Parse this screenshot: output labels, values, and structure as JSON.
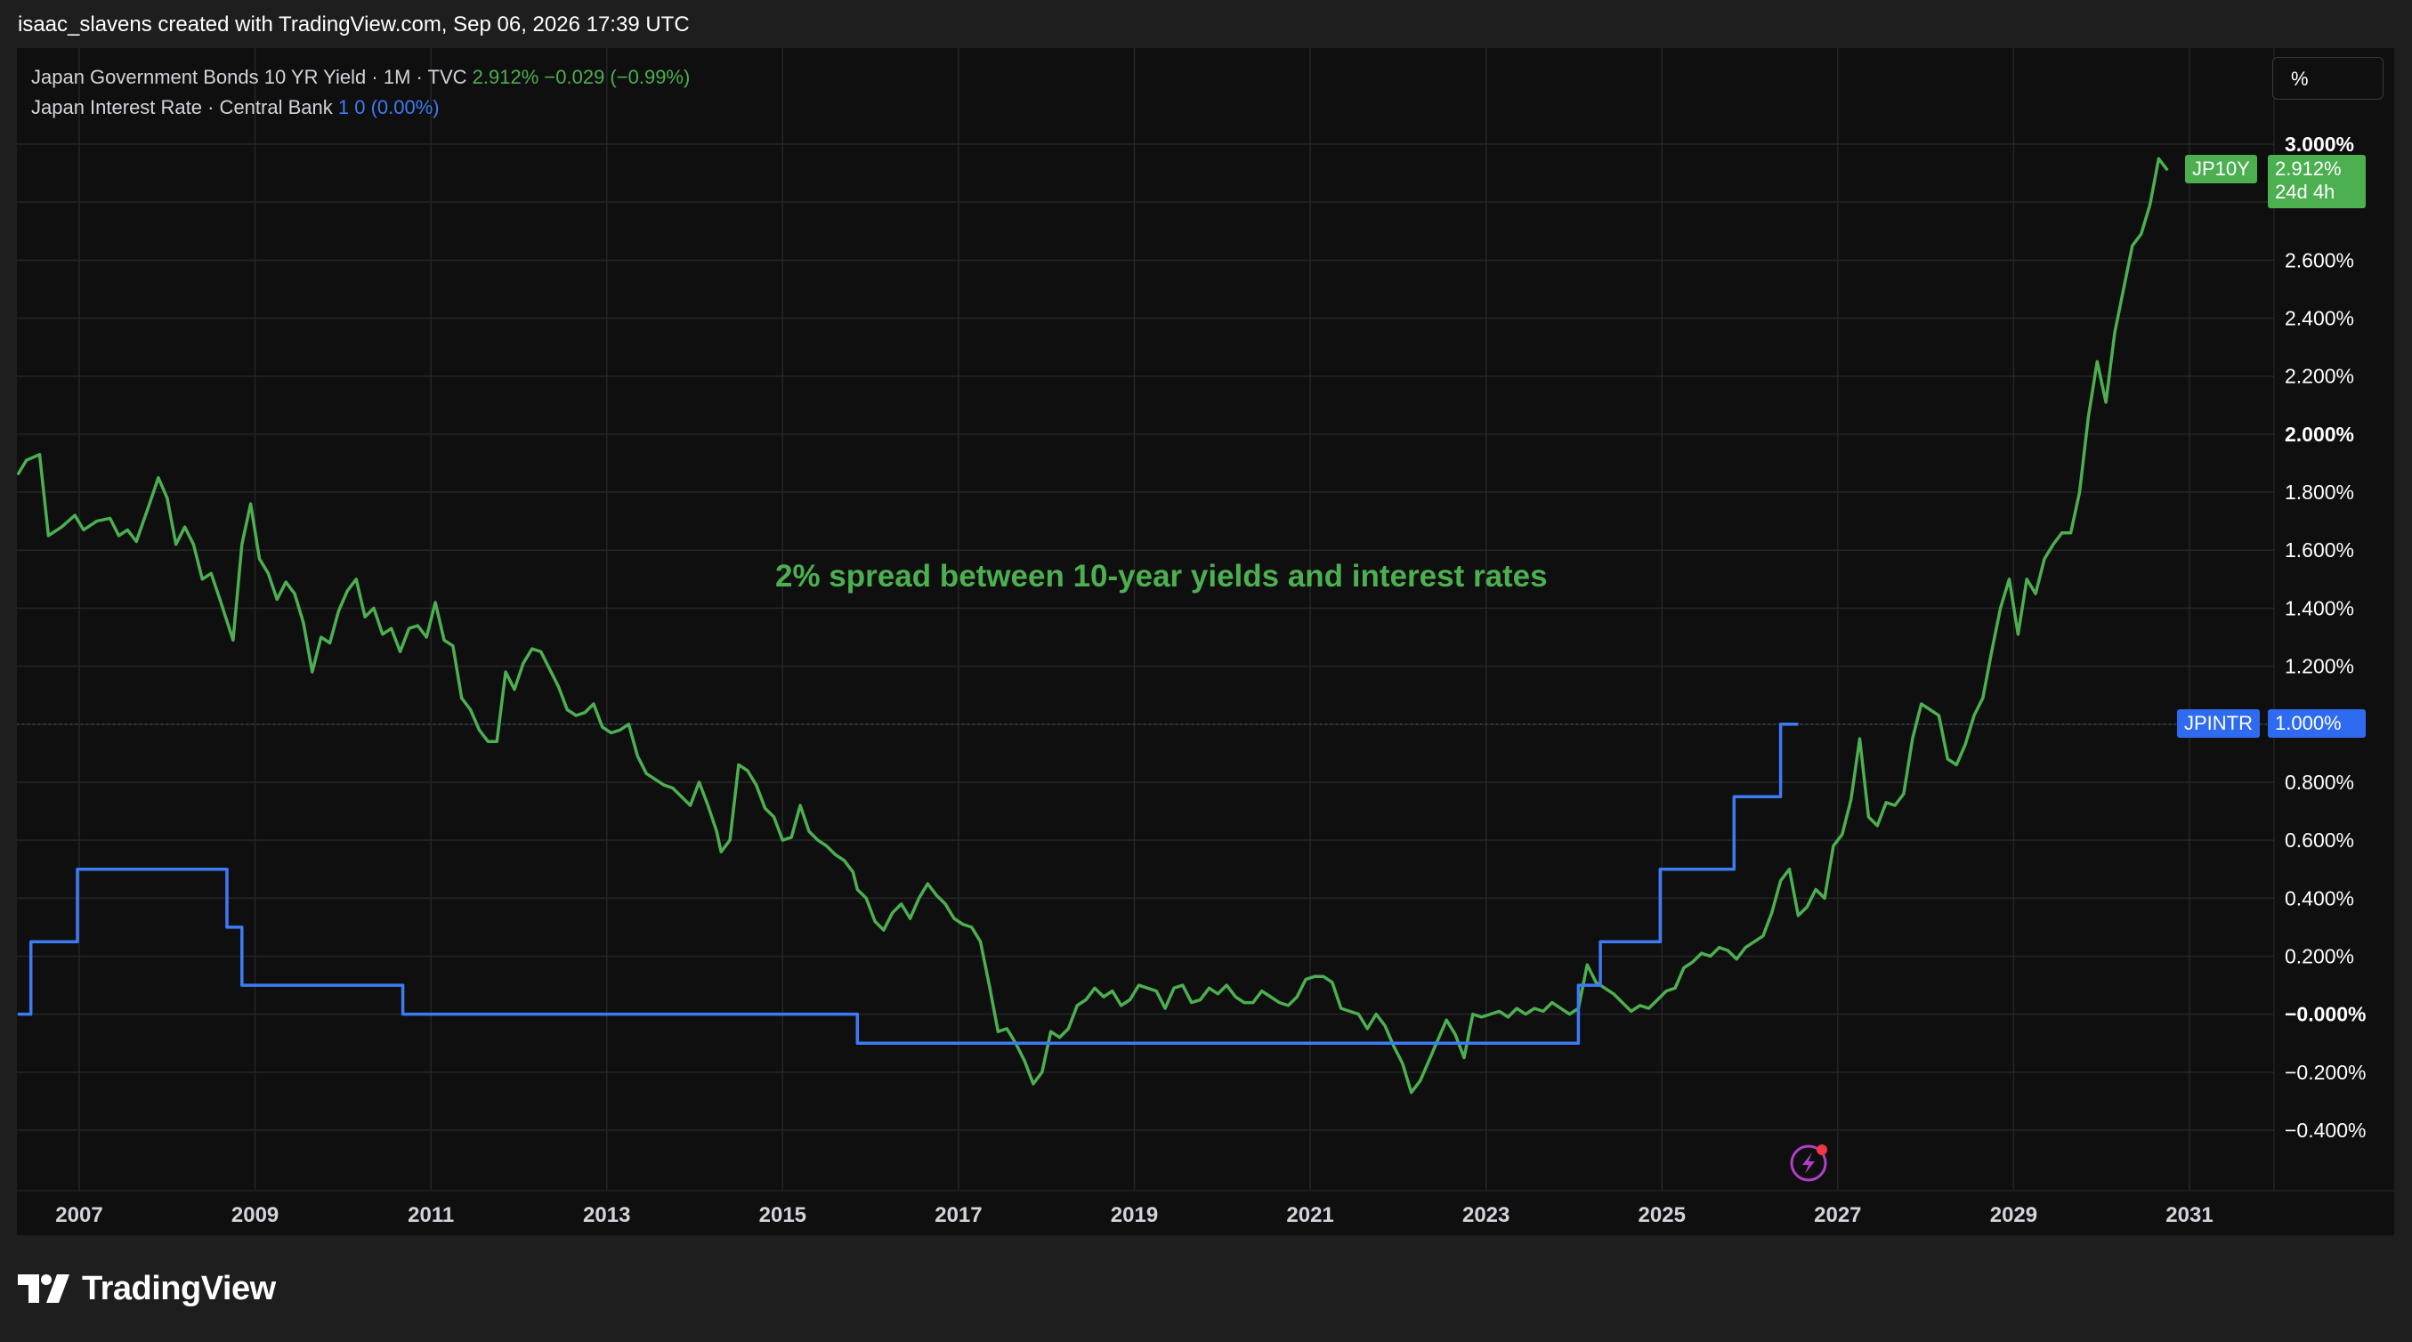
{
  "header": {
    "text": "isaac_slavens created with TradingView.com, Sep 06, 2026 17:39 UTC"
  },
  "legend": {
    "jp10y": {
      "label": "Japan Government Bonds 10 YR Yield · 1M · TVC",
      "value": "2.912%",
      "change": "−0.029 (−0.99%)"
    },
    "jpintr": {
      "label": "Japan Interest Rate · Central Bank",
      "value": "1",
      "change": "0 (0.00%)"
    }
  },
  "toolbar": {
    "percent_label": "%"
  },
  "annotation": {
    "text": "2% spread between 10-year yields and interest rates"
  },
  "price_tags": {
    "jp10y": {
      "symbol": "JP10Y",
      "value": "2.912%",
      "countdown": "24d 4h"
    },
    "jpintr": {
      "symbol": "JPINTR",
      "value": "1.000%"
    }
  },
  "footer": {
    "brand": "TradingView"
  },
  "colors": {
    "jp10y": "#4caf50",
    "jpintr": "#3d7bf5",
    "background": "#0f0f0f",
    "grid": "#2a2a2a"
  },
  "chart_data": {
    "type": "line",
    "x_range": [
      2006.3,
      2031.9
    ],
    "y_range": [
      -0.5,
      3.05
    ],
    "x_ticks": [
      "2007",
      "2009",
      "2011",
      "2013",
      "2015",
      "2017",
      "2019",
      "2021",
      "2023",
      "2025",
      "2027",
      "2029",
      "2031"
    ],
    "y_ticks": [
      "3.000%",
      "2.600%",
      "2.400%",
      "2.200%",
      "2.000%",
      "1.800%",
      "1.600%",
      "1.400%",
      "1.200%",
      "0.800%",
      "0.600%",
      "0.400%",
      "0.200%",
      "−0.000%",
      "−0.200%",
      "−0.400%"
    ],
    "series": [
      {
        "name": "Japan Government Bonds 10 YR Yield",
        "points": [
          [
            2006.3,
            1.86
          ],
          [
            2006.4,
            1.91
          ],
          [
            2006.55,
            1.93
          ],
          [
            2006.65,
            1.65
          ],
          [
            2006.8,
            1.68
          ],
          [
            2006.95,
            1.72
          ],
          [
            2007.05,
            1.67
          ],
          [
            2007.2,
            1.7
          ],
          [
            2007.35,
            1.71
          ],
          [
            2007.45,
            1.65
          ],
          [
            2007.55,
            1.67
          ],
          [
            2007.65,
            1.63
          ],
          [
            2007.8,
            1.76
          ],
          [
            2007.9,
            1.85
          ],
          [
            2008.0,
            1.78
          ],
          [
            2008.1,
            1.62
          ],
          [
            2008.2,
            1.68
          ],
          [
            2008.3,
            1.62
          ],
          [
            2008.4,
            1.5
          ],
          [
            2008.5,
            1.52
          ],
          [
            2008.6,
            1.43
          ],
          [
            2008.75,
            1.29
          ],
          [
            2008.85,
            1.62
          ],
          [
            2008.95,
            1.76
          ],
          [
            2009.05,
            1.57
          ],
          [
            2009.15,
            1.52
          ],
          [
            2009.25,
            1.43
          ],
          [
            2009.35,
            1.49
          ],
          [
            2009.45,
            1.45
          ],
          [
            2009.55,
            1.35
          ],
          [
            2009.65,
            1.18
          ],
          [
            2009.75,
            1.3
          ],
          [
            2009.85,
            1.28
          ],
          [
            2009.95,
            1.39
          ],
          [
            2010.05,
            1.46
          ],
          [
            2010.15,
            1.5
          ],
          [
            2010.25,
            1.37
          ],
          [
            2010.35,
            1.4
          ],
          [
            2010.45,
            1.31
          ],
          [
            2010.55,
            1.33
          ],
          [
            2010.65,
            1.25
          ],
          [
            2010.75,
            1.33
          ],
          [
            2010.85,
            1.34
          ],
          [
            2010.95,
            1.3
          ],
          [
            2011.05,
            1.42
          ],
          [
            2011.15,
            1.29
          ],
          [
            2011.25,
            1.27
          ],
          [
            2011.35,
            1.09
          ],
          [
            2011.45,
            1.05
          ],
          [
            2011.55,
            0.98
          ],
          [
            2011.65,
            0.94
          ],
          [
            2011.75,
            0.94
          ],
          [
            2011.85,
            1.18
          ],
          [
            2011.95,
            1.12
          ],
          [
            2012.05,
            1.21
          ],
          [
            2012.15,
            1.26
          ],
          [
            2012.25,
            1.25
          ],
          [
            2012.35,
            1.19
          ],
          [
            2012.45,
            1.13
          ],
          [
            2012.55,
            1.05
          ],
          [
            2012.65,
            1.03
          ],
          [
            2012.75,
            1.04
          ],
          [
            2012.85,
            1.07
          ],
          [
            2012.95,
            0.99
          ],
          [
            2013.05,
            0.97
          ],
          [
            2013.15,
            0.98
          ],
          [
            2013.25,
            1.0
          ],
          [
            2013.35,
            0.89
          ],
          [
            2013.45,
            0.83
          ],
          [
            2013.55,
            0.81
          ],
          [
            2013.65,
            0.79
          ],
          [
            2013.75,
            0.78
          ],
          [
            2013.85,
            0.75
          ],
          [
            2013.95,
            0.72
          ],
          [
            2014.05,
            0.8
          ],
          [
            2014.15,
            0.72
          ],
          [
            2014.25,
            0.63
          ],
          [
            2014.3,
            0.56
          ],
          [
            2014.4,
            0.6
          ],
          [
            2014.5,
            0.86
          ],
          [
            2014.6,
            0.84
          ],
          [
            2014.7,
            0.79
          ],
          [
            2014.8,
            0.71
          ],
          [
            2014.9,
            0.68
          ],
          [
            2015.0,
            0.6
          ],
          [
            2015.1,
            0.61
          ],
          [
            2015.2,
            0.72
          ],
          [
            2015.3,
            0.63
          ],
          [
            2015.4,
            0.6
          ],
          [
            2015.5,
            0.58
          ],
          [
            2015.6,
            0.55
          ],
          [
            2015.7,
            0.53
          ],
          [
            2015.8,
            0.49
          ],
          [
            2015.85,
            0.43
          ],
          [
            2015.95,
            0.4
          ],
          [
            2016.05,
            0.32
          ],
          [
            2016.15,
            0.29
          ],
          [
            2016.25,
            0.35
          ],
          [
            2016.35,
            0.38
          ],
          [
            2016.45,
            0.33
          ],
          [
            2016.55,
            0.4
          ],
          [
            2016.65,
            0.45
          ],
          [
            2016.75,
            0.41
          ],
          [
            2016.85,
            0.38
          ],
          [
            2016.95,
            0.33
          ],
          [
            2017.05,
            0.31
          ],
          [
            2017.15,
            0.3
          ],
          [
            2017.25,
            0.25
          ],
          [
            2017.35,
            0.1
          ],
          [
            2017.45,
            -0.06
          ],
          [
            2017.55,
            -0.05
          ],
          [
            2017.65,
            -0.1
          ],
          [
            2017.75,
            -0.16
          ],
          [
            2017.85,
            -0.24
          ],
          [
            2017.95,
            -0.2
          ],
          [
            2018.05,
            -0.06
          ],
          [
            2018.15,
            -0.08
          ],
          [
            2018.25,
            -0.05
          ],
          [
            2018.35,
            0.03
          ],
          [
            2018.45,
            0.05
          ],
          [
            2018.55,
            0.09
          ],
          [
            2018.65,
            0.06
          ],
          [
            2018.75,
            0.08
          ],
          [
            2018.85,
            0.03
          ],
          [
            2018.95,
            0.05
          ],
          [
            2019.05,
            0.1
          ],
          [
            2019.15,
            0.09
          ],
          [
            2019.25,
            0.08
          ],
          [
            2019.35,
            0.02
          ],
          [
            2019.45,
            0.09
          ],
          [
            2019.55,
            0.1
          ],
          [
            2019.65,
            0.04
          ],
          [
            2019.75,
            0.05
          ],
          [
            2019.85,
            0.09
          ],
          [
            2019.95,
            0.07
          ],
          [
            2020.05,
            0.1
          ],
          [
            2020.15,
            0.06
          ],
          [
            2020.25,
            0.04
          ],
          [
            2020.35,
            0.04
          ],
          [
            2020.45,
            0.08
          ],
          [
            2020.55,
            0.06
          ],
          [
            2020.65,
            0.04
          ],
          [
            2020.75,
            0.03
          ],
          [
            2020.85,
            0.06
          ],
          [
            2020.95,
            0.12
          ],
          [
            2021.05,
            0.13
          ],
          [
            2021.15,
            0.13
          ],
          [
            2021.25,
            0.11
          ],
          [
            2021.35,
            0.02
          ],
          [
            2021.45,
            0.01
          ],
          [
            2021.55,
            0.0
          ],
          [
            2021.65,
            -0.05
          ],
          [
            2021.75,
            0.0
          ],
          [
            2021.85,
            -0.04
          ],
          [
            2021.95,
            -0.11
          ],
          [
            2022.05,
            -0.17
          ],
          [
            2022.15,
            -0.27
          ],
          [
            2022.25,
            -0.23
          ],
          [
            2022.35,
            -0.16
          ],
          [
            2022.45,
            -0.09
          ],
          [
            2022.55,
            -0.02
          ],
          [
            2022.65,
            -0.07
          ],
          [
            2022.75,
            -0.15
          ],
          [
            2022.85,
            0.0
          ],
          [
            2022.95,
            -0.01
          ],
          [
            2023.05,
            0.0
          ],
          [
            2023.15,
            0.01
          ],
          [
            2023.25,
            -0.01
          ],
          [
            2023.35,
            0.02
          ],
          [
            2023.45,
            0.0
          ],
          [
            2023.55,
            0.02
          ],
          [
            2023.65,
            0.01
          ],
          [
            2023.75,
            0.04
          ],
          [
            2023.85,
            0.02
          ],
          [
            2023.95,
            0.0
          ],
          [
            2024.05,
            0.02
          ],
          [
            2024.15,
            0.17
          ],
          [
            2024.25,
            0.11
          ],
          [
            2024.35,
            0.09
          ],
          [
            2024.45,
            0.07
          ],
          [
            2024.55,
            0.04
          ],
          [
            2024.65,
            0.01
          ],
          [
            2024.75,
            0.03
          ],
          [
            2024.85,
            0.02
          ],
          [
            2024.95,
            0.05
          ],
          [
            2025.05,
            0.08
          ],
          [
            2025.15,
            0.09
          ],
          [
            2025.25,
            0.16
          ],
          [
            2025.35,
            0.18
          ],
          [
            2025.45,
            0.21
          ],
          [
            2025.55,
            0.2
          ],
          [
            2025.65,
            0.23
          ],
          [
            2025.75,
            0.22
          ],
          [
            2025.85,
            0.19
          ],
          [
            2025.95,
            0.23
          ],
          [
            2026.05,
            0.25
          ],
          [
            2026.15,
            0.27
          ],
          [
            2026.25,
            0.35
          ],
          [
            2026.35,
            0.46
          ],
          [
            2026.45,
            0.5
          ],
          [
            2026.55,
            0.34
          ],
          [
            2026.65,
            0.37
          ],
          [
            2026.75,
            0.43
          ],
          [
            2026.85,
            0.4
          ],
          [
            2026.95,
            0.58
          ],
          [
            2027.05,
            0.62
          ],
          [
            2027.15,
            0.74
          ],
          [
            2027.25,
            0.95
          ],
          [
            2027.35,
            0.68
          ],
          [
            2027.45,
            0.65
          ],
          [
            2027.55,
            0.73
          ],
          [
            2027.65,
            0.72
          ],
          [
            2027.75,
            0.76
          ],
          [
            2027.85,
            0.95
          ],
          [
            2027.95,
            1.07
          ],
          [
            2028.05,
            1.05
          ],
          [
            2028.15,
            1.03
          ],
          [
            2028.25,
            0.88
          ],
          [
            2028.35,
            0.86
          ],
          [
            2028.45,
            0.93
          ],
          [
            2028.55,
            1.03
          ],
          [
            2028.65,
            1.09
          ],
          [
            2028.75,
            1.25
          ],
          [
            2028.85,
            1.4
          ],
          [
            2028.95,
            1.5
          ],
          [
            2029.05,
            1.31
          ],
          [
            2029.15,
            1.5
          ],
          [
            2029.25,
            1.45
          ],
          [
            2029.35,
            1.57
          ],
          [
            2029.45,
            1.62
          ],
          [
            2029.55,
            1.66
          ],
          [
            2029.65,
            1.66
          ],
          [
            2029.75,
            1.8
          ],
          [
            2029.85,
            2.06
          ],
          [
            2029.95,
            2.25
          ],
          [
            2030.05,
            2.11
          ],
          [
            2030.15,
            2.35
          ],
          [
            2030.25,
            2.5
          ],
          [
            2030.35,
            2.65
          ],
          [
            2030.45,
            2.69
          ],
          [
            2030.55,
            2.79
          ],
          [
            2030.6,
            2.87
          ],
          [
            2030.65,
            2.95
          ],
          [
            2030.75,
            2.91
          ]
        ]
      },
      {
        "name": "Japan Interest Rate",
        "points": [
          [
            2006.3,
            0.0
          ],
          [
            2006.45,
            0.0
          ],
          [
            2006.45,
            0.25
          ],
          [
            2006.98,
            0.25
          ],
          [
            2006.98,
            0.5
          ],
          [
            2008.68,
            0.5
          ],
          [
            2008.68,
            0.3
          ],
          [
            2008.85,
            0.3
          ],
          [
            2008.85,
            0.1
          ],
          [
            2010.68,
            0.1
          ],
          [
            2010.68,
            0.0
          ],
          [
            2015.85,
            0.0
          ],
          [
            2015.85,
            -0.1
          ],
          [
            2024.05,
            -0.1
          ],
          [
            2024.05,
            0.1
          ],
          [
            2024.3,
            0.1
          ],
          [
            2024.3,
            0.25
          ],
          [
            2024.98,
            0.25
          ],
          [
            2024.98,
            0.5
          ],
          [
            2025.82,
            0.5
          ],
          [
            2025.82,
            0.75
          ],
          [
            2026.35,
            0.75
          ],
          [
            2026.35,
            1.0
          ],
          [
            2026.55,
            1.0
          ]
        ]
      }
    ]
  }
}
